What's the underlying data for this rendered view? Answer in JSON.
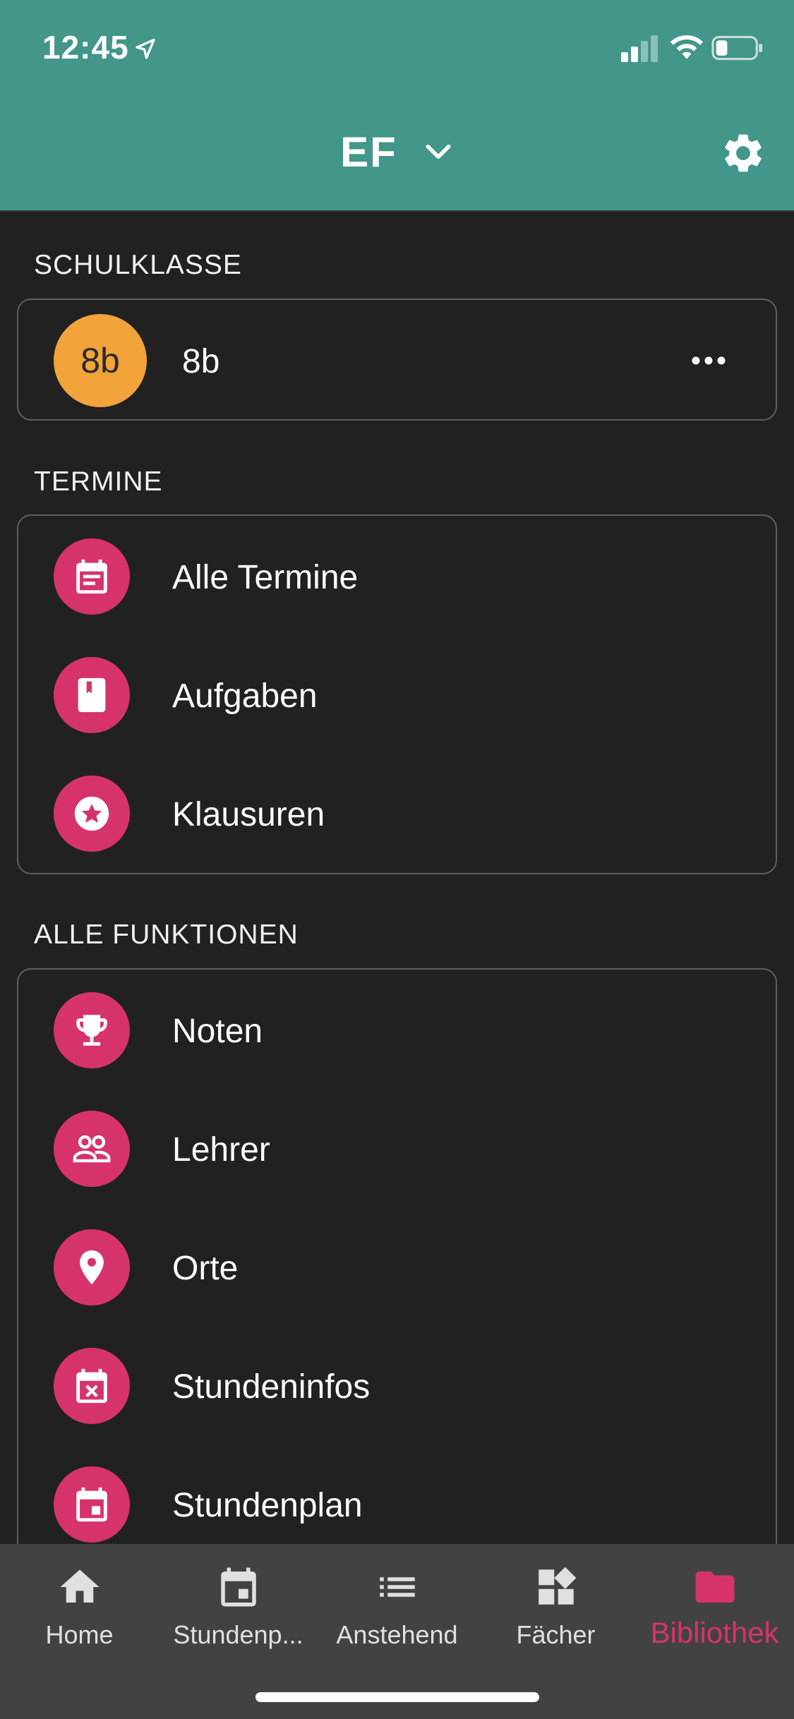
{
  "status_bar": {
    "time": "12:45"
  },
  "header": {
    "title": "EF"
  },
  "sections": {
    "schulklasse": "SCHULKLASSE",
    "termine": "TERMINE",
    "alle_funktionen": "ALLE FUNKTIONEN"
  },
  "class_card": {
    "avatar_text": "8b",
    "name": "8b"
  },
  "termine_items": [
    {
      "label": "Alle Termine",
      "icon": "calendar-list-icon"
    },
    {
      "label": "Aufgaben",
      "icon": "book-icon"
    },
    {
      "label": "Klausuren",
      "icon": "star-circle-icon"
    }
  ],
  "funktionen_items": [
    {
      "label": "Noten",
      "icon": "trophy-icon"
    },
    {
      "label": "Lehrer",
      "icon": "people-icon"
    },
    {
      "label": "Orte",
      "icon": "location-pin-icon"
    },
    {
      "label": "Stundeninfos",
      "icon": "calendar-x-icon"
    },
    {
      "label": "Stundenplan",
      "icon": "calendar-icon"
    }
  ],
  "bottom_nav": [
    {
      "label": "Home",
      "icon": "home-icon"
    },
    {
      "label": "Stundenp...",
      "icon": "calendar-icon"
    },
    {
      "label": "Anstehend",
      "icon": "list-icon"
    },
    {
      "label": "Fächer",
      "icon": "widgets-icon"
    },
    {
      "label": "Bibliothek",
      "icon": "folder-icon",
      "active": true
    }
  ],
  "colors": {
    "header_bg": "#42968A",
    "background": "#212121",
    "accent": "#D6336C",
    "avatar": "#F2A33A",
    "nav_bg": "#424242"
  }
}
